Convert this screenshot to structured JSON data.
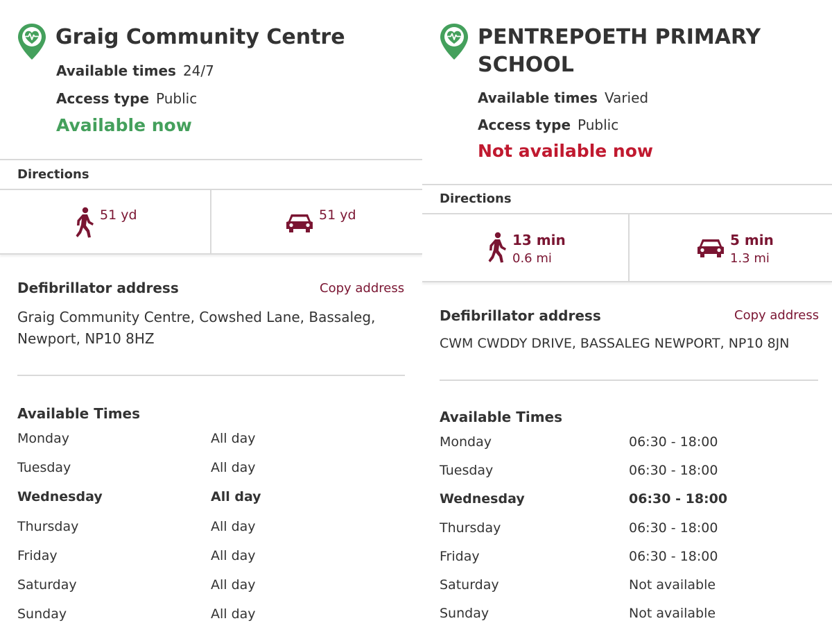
{
  "colors": {
    "available": "#44a05c",
    "not_available": "#c0192f",
    "accent": "#7a1532",
    "pin": "#44a05c"
  },
  "left": {
    "title": "Graig Community Centre",
    "available_times_label": "Available times",
    "available_times_value": "24/7",
    "access_type_label": "Access type",
    "access_type_value": "Public",
    "status": "Available now",
    "directions_label": "Directions",
    "walk": {
      "icon": "walking-person-icon",
      "main": "51 yd"
    },
    "drive": {
      "icon": "car-icon",
      "main": "51 yd"
    },
    "address_heading": "Defibrillator address",
    "copy_address": "Copy address",
    "address_line1": "Graig Community Centre, Cowshed Lane, Bassaleg,",
    "address_line2": "Newport, NP10 8HZ",
    "times_heading": "Available Times",
    "times": [
      {
        "day": "Monday",
        "hours": "All day"
      },
      {
        "day": "Tuesday",
        "hours": "All day"
      },
      {
        "day": "Wednesday",
        "hours": "All day"
      },
      {
        "day": "Thursday",
        "hours": "All day"
      },
      {
        "day": "Friday",
        "hours": "All day"
      },
      {
        "day": "Saturday",
        "hours": "All day"
      },
      {
        "day": "Sunday",
        "hours": "All day"
      }
    ]
  },
  "right": {
    "title_line1": "PENTREPOETH PRIMARY",
    "title_line2": "SCHOOL",
    "available_times_label": "Available times",
    "available_times_value": "Varied",
    "access_type_label": "Access type",
    "access_type_value": "Public",
    "status": "Not available now",
    "directions_label": "Directions",
    "walk": {
      "icon": "walking-person-icon",
      "main": "13 min",
      "sub": "0.6 mi"
    },
    "drive": {
      "icon": "car-icon",
      "main": "5 min",
      "sub": "1.3 mi"
    },
    "address_heading": "Defibrillator address",
    "copy_address": "Copy address",
    "address_line1": "CWM CWDDY DRIVE, BASSALEG NEWPORT, NP10 8JN",
    "times_heading": "Available Times",
    "times": [
      {
        "day": "Monday",
        "hours": "06:30 - 18:00"
      },
      {
        "day": "Tuesday",
        "hours": "06:30 - 18:00"
      },
      {
        "day": "Wednesday",
        "hours": "06:30 - 18:00"
      },
      {
        "day": "Thursday",
        "hours": "06:30 - 18:00"
      },
      {
        "day": "Friday",
        "hours": "06:30 - 18:00"
      },
      {
        "day": "Saturday",
        "hours": "Not available"
      },
      {
        "day": "Sunday",
        "hours": "Not available"
      }
    ]
  }
}
